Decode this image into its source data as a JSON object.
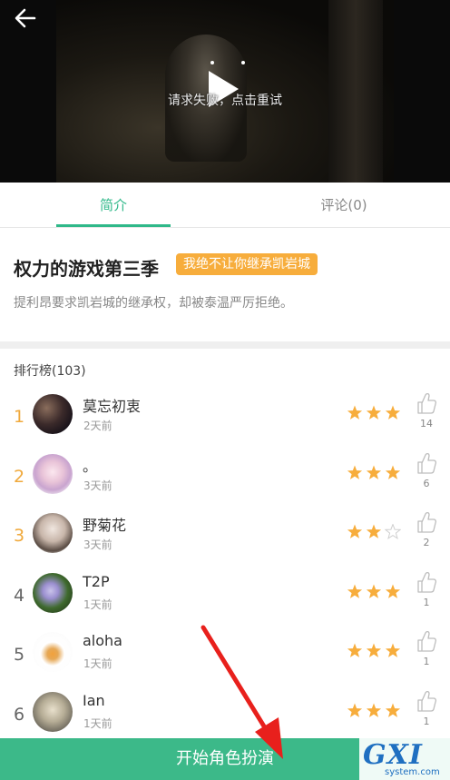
{
  "video": {
    "message": "请求失败，点击重试"
  },
  "tabs": [
    {
      "label": "简介",
      "active": true
    },
    {
      "label": "评论(0)",
      "active": false
    }
  ],
  "story": {
    "title": "权力的游戏第三季",
    "badge": "我绝不让你继承凯岩城",
    "description": "提利昂要求凯岩城的继承权，却被泰温严厉拒绝。"
  },
  "ranking": {
    "header": "排行榜(103)",
    "rows": [
      {
        "rank": "1",
        "name": "莫忘初衷",
        "time": "2天前",
        "stars": 3,
        "likes": "14",
        "highlight": true
      },
      {
        "rank": "2",
        "name": "。",
        "time": "3天前",
        "stars": 3,
        "likes": "6",
        "highlight": true
      },
      {
        "rank": "3",
        "name": "野菊花",
        "time": "3天前",
        "stars": 2,
        "likes": "2",
        "highlight": true
      },
      {
        "rank": "4",
        "name": "T2P",
        "time": "1天前",
        "stars": 3,
        "likes": "1",
        "highlight": false
      },
      {
        "rank": "5",
        "name": "aloha",
        "time": "1天前",
        "stars": 3,
        "likes": "1",
        "highlight": false
      },
      {
        "rank": "6",
        "name": "Ian",
        "time": "1天前",
        "stars": 3,
        "likes": "1",
        "highlight": false
      }
    ]
  },
  "bottom": {
    "start_label": "开始角色扮演"
  },
  "watermark": {
    "main": "GXI网",
    "sub": "system.com"
  },
  "colors": {
    "accent": "#2fb889",
    "gold": "#f0a93c",
    "star": "#f7ad3c",
    "button": "#3cb989",
    "arrow": "#e8201c"
  }
}
